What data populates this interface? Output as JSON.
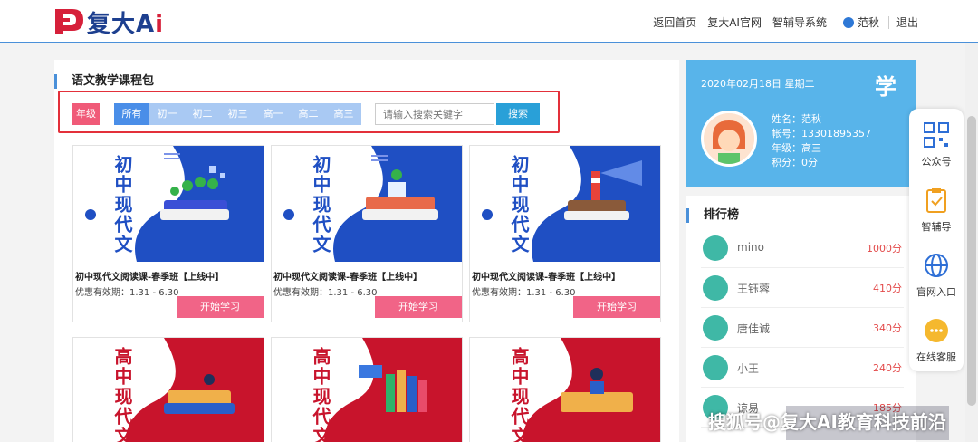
{
  "header": {
    "logo_text": "复大",
    "logo_ai_a": "A",
    "logo_ai_i": "i",
    "nav": {
      "home": "返回首页",
      "official": "复大AI官网",
      "tutor_system": "智辅导系统",
      "user": "范秋",
      "logout": "退出"
    },
    "accent": "#4a90d9"
  },
  "main": {
    "title": "语文教学课程包",
    "grade_label": "年级",
    "tabs": [
      "所有",
      "初一",
      "初二",
      "初三",
      "高一",
      "高二",
      "高三"
    ],
    "active_tab": 0,
    "search": {
      "placeholder": "请输入搜索关键字",
      "button": "搜索"
    },
    "courses": [
      {
        "cover_text": "初中现代文",
        "title": "初中现代文阅读课-春季班【上线中】",
        "date": "优惠有效期：1.31 - 6.30",
        "button": "开始学习",
        "color": "#1f4fc3"
      },
      {
        "cover_text": "初中现代文",
        "title": "初中现代文阅读课-春季班【上线中】",
        "date": "优惠有效期：1.31 - 6.30",
        "button": "开始学习",
        "color": "#1f4fc3"
      },
      {
        "cover_text": "初中现代文",
        "title": "初中现代文阅读课-春季班【上线中】",
        "date": "优惠有效期：1.31 - 6.30",
        "button": "开始学习",
        "color": "#1f4fc3"
      },
      {
        "cover_text": "高中现代文",
        "color": "#c8142c"
      },
      {
        "cover_text": "高中现代文",
        "color": "#c8142c"
      },
      {
        "cover_text": "高中现代文",
        "color": "#c8142c"
      }
    ]
  },
  "profile": {
    "date": "2020年02月18日 星期二",
    "deco": "学",
    "name": "姓名：范秋",
    "account": "帐号：13301895357",
    "grade": "年级：高三",
    "points": "积分：0分"
  },
  "ranking": {
    "title": "排行榜",
    "rows": [
      {
        "name": "mino",
        "score": "1000分"
      },
      {
        "name": "王钰蓉",
        "score": "410分"
      },
      {
        "name": "唐佳诚",
        "score": "340分"
      },
      {
        "name": "小王",
        "score": "240分"
      },
      {
        "name": "谅易",
        "score": "185分"
      }
    ]
  },
  "sidebar": {
    "items": [
      {
        "icon": "qrcode-icon",
        "label": "公众号"
      },
      {
        "icon": "clipboard-icon",
        "label": "智辅导"
      },
      {
        "icon": "globe-icon",
        "label": "官网入口"
      },
      {
        "icon": "chat-icon",
        "label": "在线客服"
      }
    ]
  },
  "watermark": "搜狐号@复大AI教育科技前沿"
}
